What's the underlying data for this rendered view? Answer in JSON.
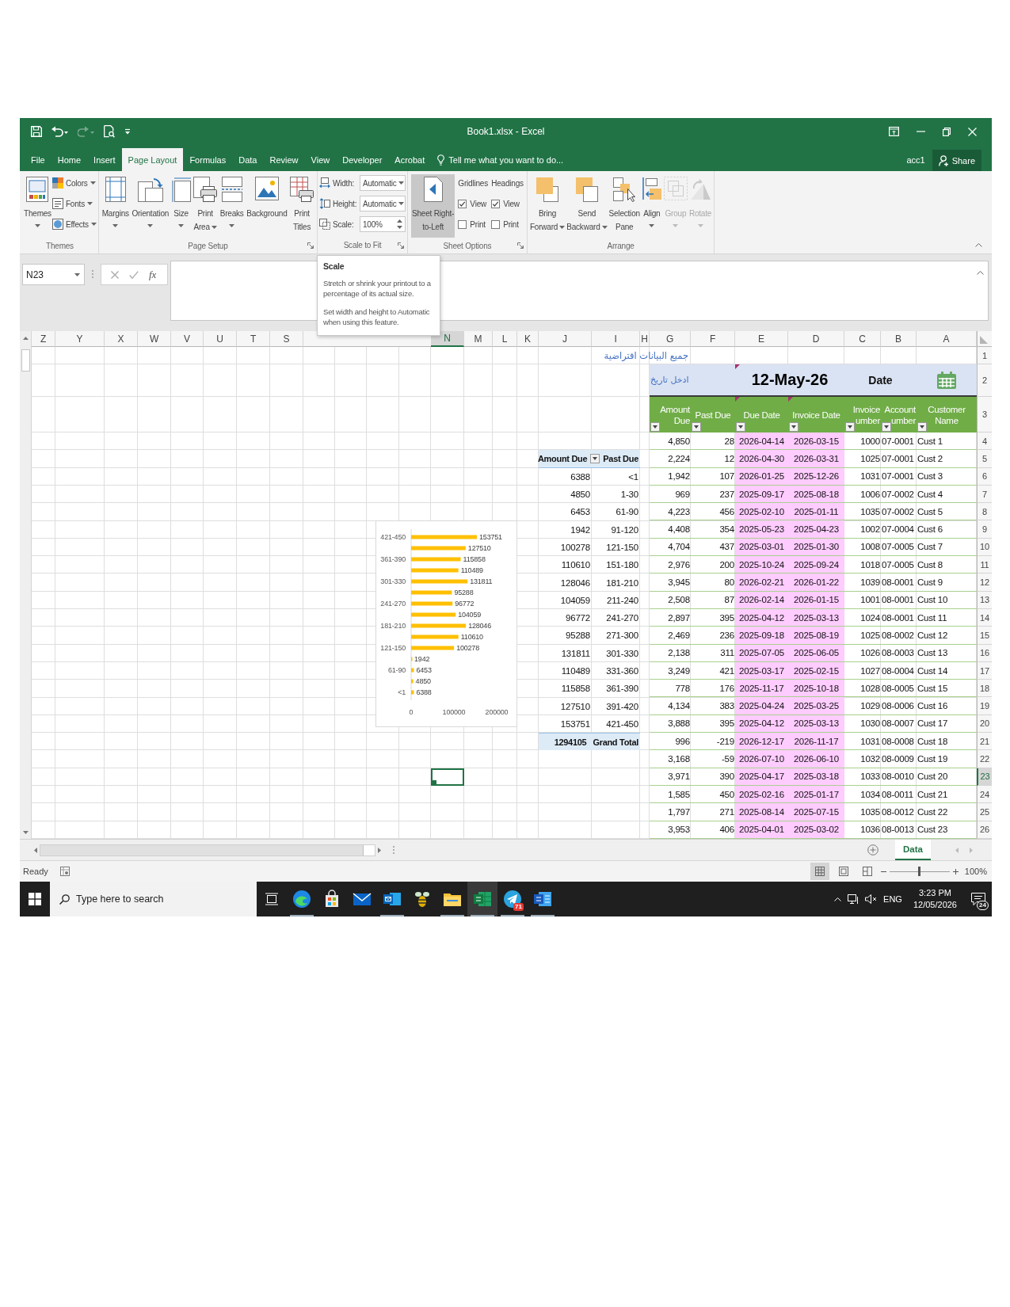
{
  "window": {
    "title": "Book1.xlsx - Excel"
  },
  "quick_access": [
    {
      "kind": "save",
      "disabled": false
    },
    {
      "kind": "undo",
      "disabled": false
    },
    {
      "kind": "redo",
      "disabled": true
    },
    {
      "kind": "print_preview",
      "disabled": false
    },
    {
      "kind": "customize",
      "disabled": false
    }
  ],
  "ribbon_tabs": [
    {
      "label": "File",
      "selected": false
    },
    {
      "label": "Home",
      "selected": false
    },
    {
      "label": "Insert",
      "selected": false
    },
    {
      "label": "Page Layout",
      "selected": true
    },
    {
      "label": "Formulas",
      "selected": false
    },
    {
      "label": "Data",
      "selected": false
    },
    {
      "label": "Review",
      "selected": false
    },
    {
      "label": "View",
      "selected": false
    },
    {
      "label": "Developer",
      "selected": false
    },
    {
      "label": "Acrobat",
      "selected": false
    }
  ],
  "tell_me": {
    "placeholder": "Tell me what you want to do..."
  },
  "account": {
    "name": "acc1",
    "share": "Share"
  },
  "ribbon": {
    "groups": [
      {
        "label": "Themes",
        "launcher": false,
        "items": [
          {
            "kind": "large",
            "label": "Themes",
            "dropdown": true,
            "disabled": false,
            "pressed": false
          },
          {
            "kind": "stack",
            "items": [
              {
                "label": "Colors",
                "dropdown": true
              },
              {
                "label": "Fonts",
                "dropdown": true
              },
              {
                "label": "Effects",
                "dropdown": true
              }
            ]
          }
        ]
      },
      {
        "label": "Page Setup",
        "launcher": true,
        "items": [
          {
            "kind": "large",
            "label": "Margins",
            "dropdown": true,
            "disabled": false,
            "pressed": false
          },
          {
            "kind": "large",
            "label": "Orientation",
            "dropdown": true,
            "disabled": false,
            "pressed": false
          },
          {
            "kind": "large",
            "label": "Size",
            "dropdown": true,
            "disabled": false,
            "pressed": false
          },
          {
            "kind": "large",
            "label": "Print\nArea",
            "dropdown": true,
            "disabled": false,
            "pressed": false
          },
          {
            "kind": "large",
            "label": "Breaks",
            "dropdown": true,
            "disabled": false,
            "pressed": false
          },
          {
            "kind": "large",
            "label": "Background",
            "dropdown": false,
            "disabled": false,
            "pressed": false
          },
          {
            "kind": "large",
            "label": "Print\nTitles",
            "dropdown": false,
            "disabled": false,
            "pressed": false
          }
        ]
      },
      {
        "label": "Scale to Fit",
        "launcher": true,
        "items": [
          {
            "kind": "fields",
            "items": [
              {
                "label": "Width:",
                "value": "Automatic",
                "kind": "dropdown"
              },
              {
                "label": "Height:",
                "value": "Automatic",
                "kind": "dropdown"
              },
              {
                "label": "Scale:",
                "value": "100%",
                "kind": "spinner"
              }
            ]
          }
        ]
      },
      {
        "label": "Sheet Options",
        "launcher": true,
        "items": [
          {
            "kind": "large",
            "label": "Sheet Right-\nto-Left",
            "dropdown": false,
            "disabled": false,
            "pressed": true
          },
          {
            "kind": "checks",
            "heading": "Gridlines",
            "items": [
              {
                "label": "View",
                "checked": true
              },
              {
                "label": "Print",
                "checked": false
              }
            ]
          },
          {
            "kind": "checks",
            "heading": "Headings",
            "items": [
              {
                "label": "View",
                "checked": true
              },
              {
                "label": "Print",
                "checked": false
              }
            ]
          }
        ]
      },
      {
        "label": "Arrange",
        "launcher": false,
        "items": [
          {
            "kind": "large",
            "label": "Bring\nForward",
            "dropdown": true,
            "disabled": false,
            "pressed": false
          },
          {
            "kind": "large",
            "label": "Send\nBackward",
            "dropdown": true,
            "disabled": false,
            "pressed": false
          },
          {
            "kind": "large",
            "label": "Selection\nPane",
            "dropdown": false,
            "disabled": false,
            "pressed": false
          },
          {
            "kind": "large",
            "label": "Align",
            "dropdown": true,
            "disabled": false,
            "pressed": false
          },
          {
            "kind": "large",
            "label": "Group",
            "dropdown": true,
            "disabled": true,
            "pressed": false
          },
          {
            "kind": "large",
            "label": "Rotate",
            "dropdown": true,
            "disabled": true,
            "pressed": false
          }
        ]
      }
    ]
  },
  "formula_bar": {
    "name_box": "N23",
    "function_label": "fx"
  },
  "tooltip": {
    "title": "Scale",
    "paragraphs": [
      "Stretch or shrink your printout to a percentage of its actual size.",
      "Set width and height to Automatic when using this feature."
    ]
  },
  "sheet": {
    "columns_left": [
      {
        "label": "Z",
        "selected": false
      },
      {
        "label": "Y",
        "selected": false
      },
      {
        "label": "X",
        "selected": false
      },
      {
        "label": "W",
        "selected": false
      },
      {
        "label": "V",
        "selected": false
      },
      {
        "label": "U",
        "selected": false
      },
      {
        "label": "T",
        "selected": false
      },
      {
        "label": "S",
        "selected": false
      }
    ],
    "columns_right": [
      {
        "label": "N",
        "selected": true
      },
      {
        "label": "M",
        "selected": false
      },
      {
        "label": "L",
        "selected": false
      },
      {
        "label": "K",
        "selected": false
      },
      {
        "label": "J",
        "selected": false
      },
      {
        "label": "I",
        "selected": false
      },
      {
        "label": "H",
        "selected": false
      },
      {
        "label": "G",
        "selected": false
      },
      {
        "label": "F",
        "selected": false
      },
      {
        "label": "E",
        "selected": false
      },
      {
        "label": "D",
        "selected": false
      },
      {
        "label": "C",
        "selected": false
      },
      {
        "label": "B",
        "selected": false
      },
      {
        "label": "A",
        "selected": false
      }
    ],
    "rows": [
      {
        "label": "1",
        "selected": false
      },
      {
        "label": "2",
        "selected": false
      },
      {
        "label": "3",
        "selected": false
      },
      {
        "label": "4",
        "selected": false
      },
      {
        "label": "5",
        "selected": false
      },
      {
        "label": "6",
        "selected": false
      },
      {
        "label": "7",
        "selected": false
      },
      {
        "label": "8",
        "selected": false
      },
      {
        "label": "9",
        "selected": false
      },
      {
        "label": "10",
        "selected": false
      },
      {
        "label": "11",
        "selected": false
      },
      {
        "label": "12",
        "selected": false
      },
      {
        "label": "13",
        "selected": false
      },
      {
        "label": "14",
        "selected": false
      },
      {
        "label": "15",
        "selected": false
      },
      {
        "label": "16",
        "selected": false
      },
      {
        "label": "17",
        "selected": false
      },
      {
        "label": "18",
        "selected": false
      },
      {
        "label": "19",
        "selected": false
      },
      {
        "label": "20",
        "selected": false
      },
      {
        "label": "21",
        "selected": false
      },
      {
        "label": "22",
        "selected": false
      },
      {
        "label": "23",
        "selected": true
      },
      {
        "label": "24",
        "selected": false
      },
      {
        "label": "25",
        "selected": false
      },
      {
        "label": "26",
        "selected": false
      }
    ],
    "note": "جميع البيانات افتراضية",
    "date_band": {
      "label": "Date",
      "value": "12-May-26",
      "value_comment": true,
      "prompt": "ادخل تاريخ"
    },
    "table": {
      "columns": [
        {
          "label": "Amount\nDue",
          "comment": false
        },
        {
          "label": "Past Due",
          "comment": false
        },
        {
          "label": "Due Date",
          "comment": true
        },
        {
          "label": "Invoice Date",
          "comment": true
        },
        {
          "label": "Invoice\number",
          "comment": false
        },
        {
          "label": "Account\number",
          "comment": false
        },
        {
          "label": "Customer\nName",
          "comment": false
        }
      ],
      "rows": [
        [
          "4,850",
          "28",
          "2026-04-14",
          "2026-03-15",
          "1000",
          "07-0001",
          "Cust 1"
        ],
        [
          "2,224",
          "12",
          "2026-04-30",
          "2026-03-31",
          "1025",
          "07-0001",
          "Cust 2"
        ],
        [
          "1,942",
          "107",
          "2026-01-25",
          "2025-12-26",
          "1031",
          "07-0001",
          "Cust 3"
        ],
        [
          "969",
          "237",
          "2025-09-17",
          "2025-08-18",
          "1006",
          "07-0002",
          "Cust 4"
        ],
        [
          "4,223",
          "456",
          "2025-02-10",
          "2025-01-11",
          "1035",
          "07-0002",
          "Cust 5"
        ],
        [
          "4,408",
          "354",
          "2025-05-23",
          "2025-04-23",
          "1002",
          "07-0004",
          "Cust 6"
        ],
        [
          "4,704",
          "437",
          "2025-03-01",
          "2025-01-30",
          "1008",
          "07-0005",
          "Cust 7"
        ],
        [
          "2,976",
          "200",
          "2025-10-24",
          "2025-09-24",
          "1018",
          "07-0005",
          "Cust 8"
        ],
        [
          "3,945",
          "80",
          "2026-02-21",
          "2026-01-22",
          "1039",
          "08-0001",
          "Cust 9"
        ],
        [
          "2,508",
          "87",
          "2026-02-14",
          "2026-01-15",
          "1001",
          "08-0001",
          "Cust 10"
        ],
        [
          "2,897",
          "395",
          "2025-04-12",
          "2025-03-13",
          "1024",
          "08-0001",
          "Cust 11"
        ],
        [
          "2,469",
          "236",
          "2025-09-18",
          "2025-08-19",
          "1025",
          "08-0002",
          "Cust 12"
        ],
        [
          "2,138",
          "311",
          "2025-07-05",
          "2025-06-05",
          "1026",
          "08-0003",
          "Cust 13"
        ],
        [
          "3,249",
          "421",
          "2025-03-17",
          "2025-02-15",
          "1027",
          "08-0004",
          "Cust 14"
        ],
        [
          "778",
          "176",
          "2025-11-17",
          "2025-10-18",
          "1028",
          "08-0005",
          "Cust 15"
        ],
        [
          "4,134",
          "383",
          "2025-04-24",
          "2025-03-25",
          "1029",
          "08-0006",
          "Cust 16"
        ],
        [
          "3,888",
          "395",
          "2025-04-12",
          "2025-03-13",
          "1030",
          "08-0007",
          "Cust 17"
        ],
        [
          "996",
          "-219",
          "2026-12-17",
          "2026-11-17",
          "1031",
          "08-0008",
          "Cust 18"
        ],
        [
          "3,168",
          "-59",
          "2026-07-10",
          "2026-06-10",
          "1032",
          "08-0009",
          "Cust 19"
        ],
        [
          "3,971",
          "390",
          "2025-04-17",
          "2025-03-18",
          "1033",
          "08-0010",
          "Cust 20"
        ],
        [
          "1,585",
          "450",
          "2025-02-16",
          "2025-01-17",
          "1034",
          "08-0011",
          "Cust 21"
        ],
        [
          "1,797",
          "271",
          "2025-08-14",
          "2025-07-15",
          "1035",
          "08-0012",
          "Cust 22"
        ],
        [
          "3,953",
          "406",
          "2025-04-01",
          "2025-03-02",
          "1036",
          "08-0013",
          "Cust 23"
        ]
      ]
    },
    "pivot": {
      "columns": [
        "Amount Due",
        "Past Due"
      ],
      "rows": [
        [
          "6388",
          "<1"
        ],
        [
          "4850",
          "1-30"
        ],
        [
          "6453",
          "61-90"
        ],
        [
          "1942",
          "91-120"
        ],
        [
          "100278",
          "121-150"
        ],
        [
          "110610",
          "151-180"
        ],
        [
          "128046",
          "181-210"
        ],
        [
          "104059",
          "211-240"
        ],
        [
          "96772",
          "241-270"
        ],
        [
          "95288",
          "271-300"
        ],
        [
          "131811",
          "301-330"
        ],
        [
          "110489",
          "331-360"
        ],
        [
          "115858",
          "361-390"
        ],
        [
          "127510",
          "391-420"
        ],
        [
          "153751",
          "421-450"
        ]
      ],
      "total": [
        "1294105",
        "Grand Total"
      ]
    },
    "chart": {
      "chart_data": {
        "type": "bar",
        "orientation": "horizontal",
        "categories": [
          "421-450",
          null,
          "361-390",
          null,
          "301-330",
          null,
          "241-270",
          null,
          "181-210",
          null,
          "121-150",
          null,
          "61-90",
          null,
          "<1"
        ],
        "series": [
          {
            "color": "#ffc000",
            "values": [
              153751,
              127510,
              115858,
              110489,
              131811,
              95288,
              96772,
              104059,
              128046,
              110610,
              100278,
              1942,
              6453,
              4850,
              6388
            ]
          }
        ],
        "xlim": [
          0,
          200000
        ],
        "xticks": [
          0,
          100000,
          200000
        ],
        "data_labels": true
      }
    }
  },
  "sheet_tabs": [
    {
      "label": "Data",
      "selected": true
    }
  ],
  "status_bar": {
    "text": "Ready",
    "views": [
      {
        "selected": true
      },
      {
        "selected": false
      },
      {
        "selected": false
      }
    ],
    "zoom": {
      "level": 0.5,
      "reading": "100%"
    }
  },
  "taskbar": {
    "search": {
      "placeholder": "Type here to search"
    },
    "apps": [
      {
        "running": true,
        "selected": false
      },
      {
        "running": false,
        "selected": false
      },
      {
        "running": false,
        "selected": false
      },
      {
        "running": true,
        "selected": false
      },
      {
        "running": false,
        "selected": false
      },
      {
        "running": true,
        "selected": false
      },
      {
        "running": true,
        "selected": true
      },
      {
        "running": true,
        "selected": false,
        "badge": "71"
      },
      {
        "running": true,
        "selected": false
      }
    ],
    "tray": {
      "language": "ENG",
      "time": "3:23 PM",
      "date": "12/05/2026",
      "notifications": "24"
    }
  }
}
